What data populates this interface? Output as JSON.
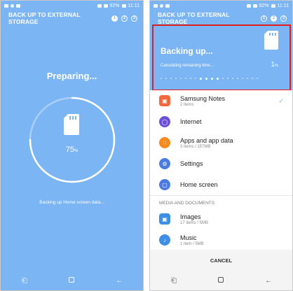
{
  "colors": {
    "primary": "#7cb5f4",
    "highlight": "#e31c1c",
    "accent_check": "#7cb5f4"
  },
  "status_bar": {
    "battery": "92%",
    "time": "11:11"
  },
  "left_screen": {
    "title": "BACK UP TO EXTERNAL STORAGE",
    "status_text": "Preparing...",
    "progress_percent": 75,
    "percent_value": "75",
    "percent_unit": "%",
    "note": "Backing up Home screen data..."
  },
  "right_screen": {
    "title": "BACK UP TO EXTERNAL STORAGE",
    "header_title": "Backing up...",
    "remaining": "Calculating remaining time...",
    "percent_value": "1",
    "percent_unit": "%",
    "items": [
      {
        "name": "Samsung Notes",
        "sub": "2 items",
        "icon": "notes-icon",
        "color": "#f2683f",
        "checked": true
      },
      {
        "name": "Internet",
        "sub": "",
        "icon": "internet-icon",
        "color": "#6b4fd8",
        "checked": false
      },
      {
        "name": "Apps and app data",
        "sub": "3 items / 157MB",
        "icon": "apps-icon",
        "color": "#f58a1f",
        "checked": false
      },
      {
        "name": "Settings",
        "sub": "",
        "icon": "settings-icon",
        "color": "#4c7be0",
        "checked": false
      },
      {
        "name": "Home screen",
        "sub": "",
        "icon": "home-screen-icon",
        "color": "#4c7be0",
        "checked": false
      }
    ],
    "section_label": "MEDIA AND DOCUMENTS",
    "media_items": [
      {
        "name": "Images",
        "sub": "17 items / 5MB",
        "icon": "images-icon",
        "color": "#3d8fe6"
      },
      {
        "name": "Music",
        "sub": "1 item / 5MB",
        "icon": "music-icon",
        "color": "#3d8fe6"
      }
    ],
    "cancel_label": "CANCEL"
  },
  "nav_icons": {
    "recent": "⎗",
    "back": "←"
  }
}
